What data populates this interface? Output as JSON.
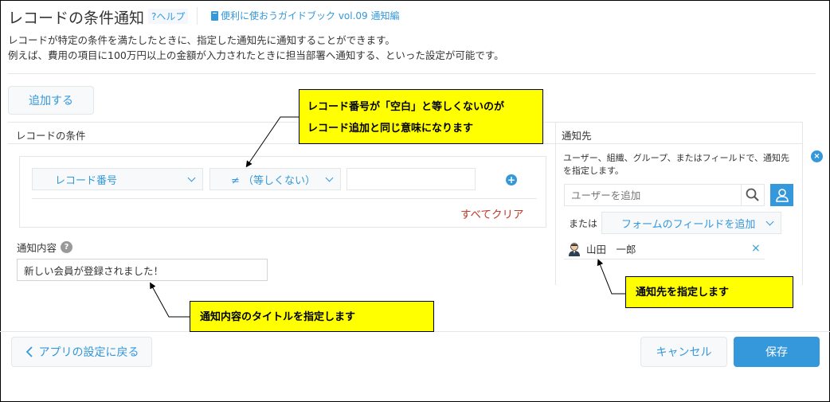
{
  "header": {
    "title": "レコードの条件通知",
    "help_link": "?ヘルプ",
    "guide_link": "便利に使おうガイドブック vol.09 通知編",
    "description_line1": "レコードが特定の条件を満たしたときに、指定した通知先に通知することができます。",
    "description_line2": "例えば、費用の項目に100万円以上の金額が入力されたときに担当部署へ通知する、といった設定が可能です。"
  },
  "toolbar": {
    "add_label": "追加する"
  },
  "condition": {
    "header": "レコードの条件",
    "field_value": "レコード番号",
    "operator_value": "≠ （等しくない）",
    "value_input": "",
    "clear_all": "すべてクリア",
    "content_label": "通知内容",
    "content_value": "新しい会員が登録されました！"
  },
  "recipients": {
    "header": "通知先",
    "description": "ユーザー、組織、グループ、またはフィールドで、通知先を指定します。",
    "user_placeholder": "ユーザーを追加",
    "or_label": "または",
    "add_field_label": "フォームのフィールドを追加",
    "users": [
      {
        "name": "山田　一郎"
      }
    ],
    "remove_glyph": "×",
    "close_glyph": "×"
  },
  "footer": {
    "back_label": "アプリの設定に戻る",
    "cancel_label": "キャンセル",
    "save_label": "保存"
  },
  "callouts": {
    "condition_line1": "レコード番号が「空白」と等しくないのが",
    "condition_line2": "レコード追加と同じ意味になります",
    "content": "通知内容のタイトルを指定します",
    "recipient": "通知先を指定します"
  },
  "colors": {
    "accent": "#3498db",
    "callout_bg": "#ffff00",
    "clear_text": "#c0392b"
  }
}
